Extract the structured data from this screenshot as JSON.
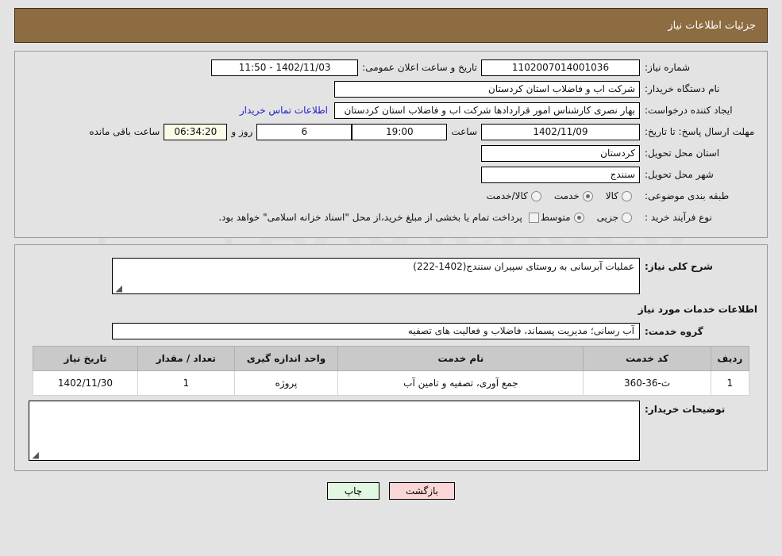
{
  "header": {
    "title": "جزئیات اطلاعات نیاز"
  },
  "form": {
    "need_number_label": "شماره نیاز:",
    "need_number_value": "1102007014001036",
    "public_announce_label": "تاریخ و ساعت اعلان عمومی:",
    "public_announce_value": "1402/11/03 - 11:50",
    "buyer_org_label": "نام دستگاه خریدار:",
    "buyer_org_value": "شرکت اب و فاضلاب استان کردستان",
    "creator_label": "ایجاد کننده درخواست:",
    "creator_value": "بهار نصری کارشناس امور قراردادها شرکت اب و فاضلاب استان کردستان",
    "contact_link": "اطلاعات تماس خریدار",
    "deadline_label": "مهلت ارسال پاسخ: تا تاریخ:",
    "deadline_date": "1402/11/09",
    "hour_label": "ساعت",
    "deadline_time": "19:00",
    "days_value": "6",
    "days_text": "روز و",
    "countdown_value": "06:34:20",
    "remaining_text": "ساعت باقی مانده",
    "province_label": "استان محل تحویل:",
    "province_value": "کردستان",
    "city_label": "شهر محل تحویل:",
    "city_value": "سنندج",
    "category_label": "طبقه بندی موضوعی:",
    "category_options": [
      {
        "label": "کالا",
        "selected": false
      },
      {
        "label": "خدمت",
        "selected": true
      },
      {
        "label": "کالا/خدمت",
        "selected": false
      }
    ],
    "process_label": "نوع فرآیند خرید :",
    "process_options": [
      {
        "label": "جزیی",
        "selected": false
      },
      {
        "label": "متوسط",
        "selected": true
      }
    ],
    "treasury_checkbox_text": "پرداخت تمام یا بخشی از مبلغ خرید،از محل \"اسناد خزانه اسلامی\" خواهد بود.",
    "treasury_checked": false
  },
  "description": {
    "label": "شرح کلی نیاز:",
    "value": "عملیات آبرسانی به روستای سپیران سنندج(1402-222)"
  },
  "services": {
    "section_title": "اطلاعات خدمات مورد نیاز",
    "group_label": "گروه خدمت:",
    "group_value": "آب رسانی؛ مدیریت پسماند، فاضلاب و فعالیت های تصفیه",
    "table": {
      "headers": [
        "ردیف",
        "کد خدمت",
        "نام خدمت",
        "واحد اندازه گیری",
        "تعداد / مقدار",
        "تاریخ نیاز"
      ],
      "rows": [
        {
          "radif": "1",
          "code": "ث-36-360",
          "name": "جمع آوری، تصفیه و تامین آب",
          "unit": "پروژه",
          "qty": "1",
          "date": "1402/11/30"
        }
      ]
    }
  },
  "buyer_comment": {
    "label": "توضیحات خریدار:",
    "value": ""
  },
  "footer": {
    "back_label": "بازگشت",
    "print_label": "چاپ"
  },
  "colors": {
    "header_bg": "#8d6c41",
    "link": "#2020cc",
    "countdown_bg": "#fbfbe8",
    "back_btn_bg": "#fad6d6",
    "print_btn_bg": "#e2f7e2"
  }
}
